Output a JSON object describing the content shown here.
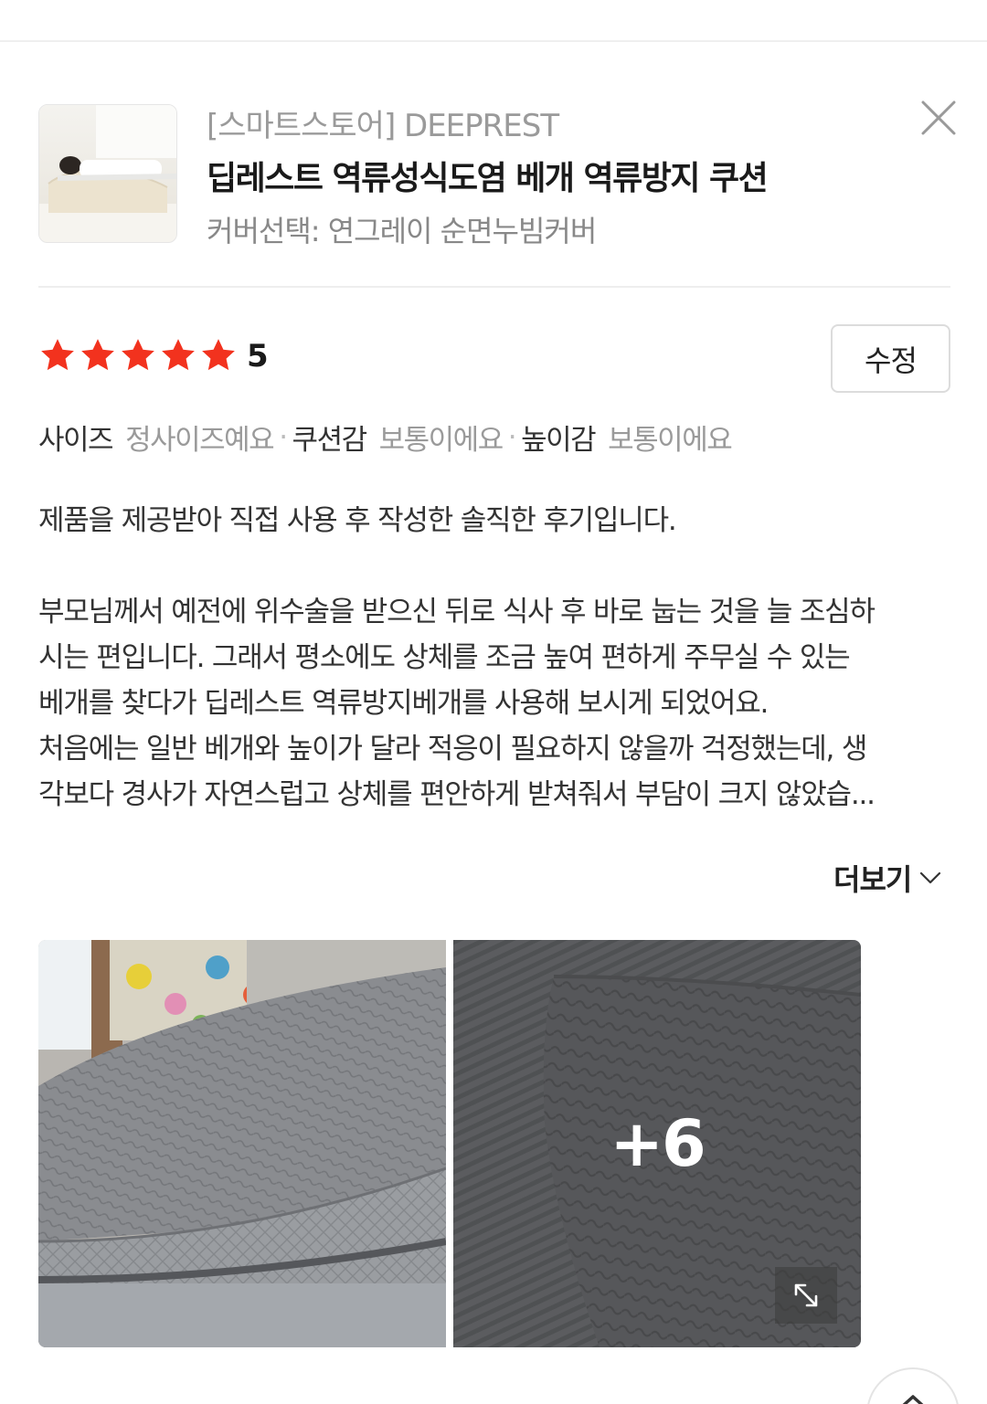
{
  "product": {
    "store": "[스마트스토어] DEEPREST",
    "title": "딥레스트 역류성식도염 베개 역류방지 쿠션",
    "option": "커버선택: 연그레이 순면누빔커버",
    "thumbnail": "pillow-product-photo"
  },
  "review": {
    "rating": 5,
    "rating_label": "5",
    "edit_label": "수정",
    "attributes": [
      {
        "label": "사이즈",
        "value": "정사이즈예요"
      },
      {
        "label": "쿠션감",
        "value": "보통이에요"
      },
      {
        "label": "높이감",
        "value": "보통이에요"
      }
    ],
    "separator": "·",
    "text_lines": [
      "제품을 제공받아 직접 사용 후 작성한 솔직한 후기입니다.",
      "",
      "부모님께서 예전에 위수술을 받으신 뒤로 식사 후 바로 눕는 것을 늘 조심하",
      "시는 편입니다. 그래서 평소에도 상체를 조금 높여 편하게 주무실 수 있는",
      "베개를 찾다가 딥레스트 역류방지베개를 사용해 보시게 되었어요.",
      "처음에는 일반 베개와 높이가 달라 적응이 필요하지 않을까 걱정했는데, 생",
      "각보다 경사가 자연스럽고 상체를 편안하게 받쳐줘서 부담이 크지 않았습..."
    ],
    "more_label": "더보기",
    "more_photos_label": "+6"
  },
  "icons": {
    "close": "close-icon",
    "star": "star-icon",
    "chevron": "chevron-down-icon",
    "expand": "expand-icon",
    "scroll_top": "arrow-up-icon"
  },
  "colors": {
    "star": "#f2321e",
    "store_text": "#9a9a9a",
    "title_text": "#1a1a1a"
  }
}
